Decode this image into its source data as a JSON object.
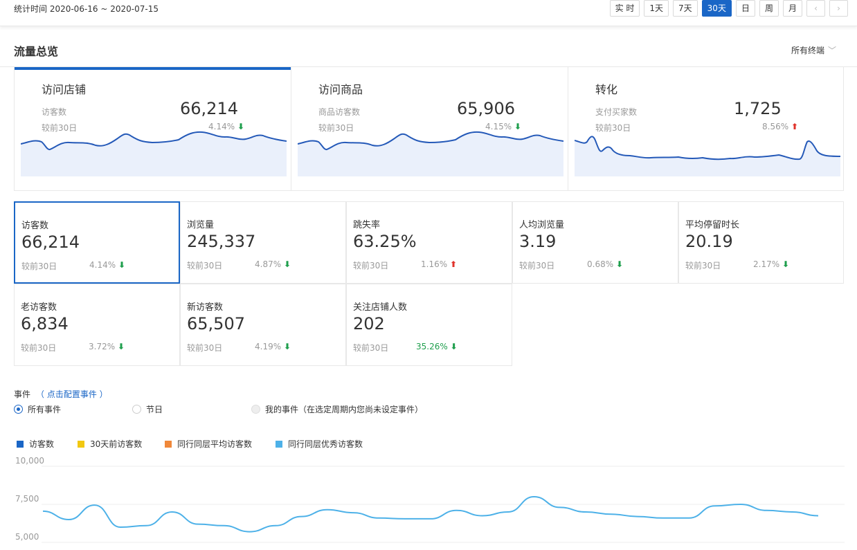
{
  "header": {
    "stat_range": "统计时间 2020-06-16 ~ 2020-07-15",
    "range_buttons": [
      "实 时",
      "1天",
      "7天",
      "30天",
      "日",
      "周",
      "月"
    ],
    "active_range": "30天",
    "prev_icon": "chevron-left-icon",
    "next_icon": "chevron-right-icon"
  },
  "section": {
    "title": "流量总览",
    "terminal": "所有终端"
  },
  "overview": [
    {
      "name": "访问店铺",
      "label": "访客数",
      "value": "66,214",
      "compare": "较前30日",
      "pct": "4.14%",
      "direction": "down",
      "active": true
    },
    {
      "name": "访问商品",
      "label": "商品访客数",
      "value": "65,906",
      "compare": "较前30日",
      "pct": "4.15%",
      "direction": "down",
      "active": false
    },
    {
      "name": "转化",
      "label": "支付买家数",
      "value": "1,725",
      "compare": "较前30日",
      "pct": "8.56%",
      "direction": "up",
      "active": false
    }
  ],
  "metrics": [
    {
      "name": "访客数",
      "value": "66,214",
      "compare": "较前30日",
      "pct": "4.14%",
      "direction": "down"
    },
    {
      "name": "浏览量",
      "value": "245,337",
      "compare": "较前30日",
      "pct": "4.87%",
      "direction": "down"
    },
    {
      "name": "跳失率",
      "value": "63.25%",
      "compare": "较前30日",
      "pct": "1.16%",
      "direction": "up"
    },
    {
      "name": "人均浏览量",
      "value": "3.19",
      "compare": "较前30日",
      "pct": "0.68%",
      "direction": "down"
    },
    {
      "name": "平均停留时长",
      "value": "20.19",
      "compare": "较前30日",
      "pct": "2.17%",
      "direction": "down"
    },
    {
      "name": "老访客数",
      "value": "6,834",
      "compare": "较前30日",
      "pct": "3.72%",
      "direction": "down"
    },
    {
      "name": "新访客数",
      "value": "65,507",
      "compare": "较前30日",
      "pct": "4.19%",
      "direction": "down"
    },
    {
      "name": "关注店铺人数",
      "value": "202",
      "compare": "较前30日",
      "pct": "35.26%",
      "direction": "down"
    }
  ],
  "events": {
    "title": "事件",
    "config_link": "（ 点击配置事件 ）",
    "options": [
      {
        "label": "所有事件",
        "state": "checked"
      },
      {
        "label": "节日",
        "state": "normal"
      },
      {
        "label": "我的事件（在选定周期内您尚未设定事件）",
        "state": "disabled"
      }
    ]
  },
  "colors": {
    "accent": "#1a66c6",
    "down": "#1e9e4c",
    "up": "#e0332b",
    "line_chart": "#4db1e8"
  },
  "chart_data": {
    "type": "line",
    "legend": [
      "访客数",
      "30天前访客数",
      "同行同层平均访客数",
      "同行同层优秀访客数"
    ],
    "legend_colors": [
      "#1a66c6",
      "#f2c811",
      "#f0883a",
      "#4db1e8"
    ],
    "y_ticks": [
      "10,000",
      "7,500",
      "5,000"
    ],
    "ylim": [
      5000,
      10000
    ],
    "grid": true,
    "series": [
      {
        "name": "同行同层优秀访客数",
        "values": [
          7050,
          6500,
          7450,
          6000,
          6100,
          7000,
          6200,
          6100,
          5700,
          6100,
          6700,
          7150,
          6950,
          6600,
          6550,
          6550,
          7100,
          6750,
          7000,
          8000,
          7300,
          7000,
          6850,
          6700,
          6600,
          6600,
          7400,
          7500,
          7100,
          7000,
          6750
        ]
      }
    ]
  }
}
